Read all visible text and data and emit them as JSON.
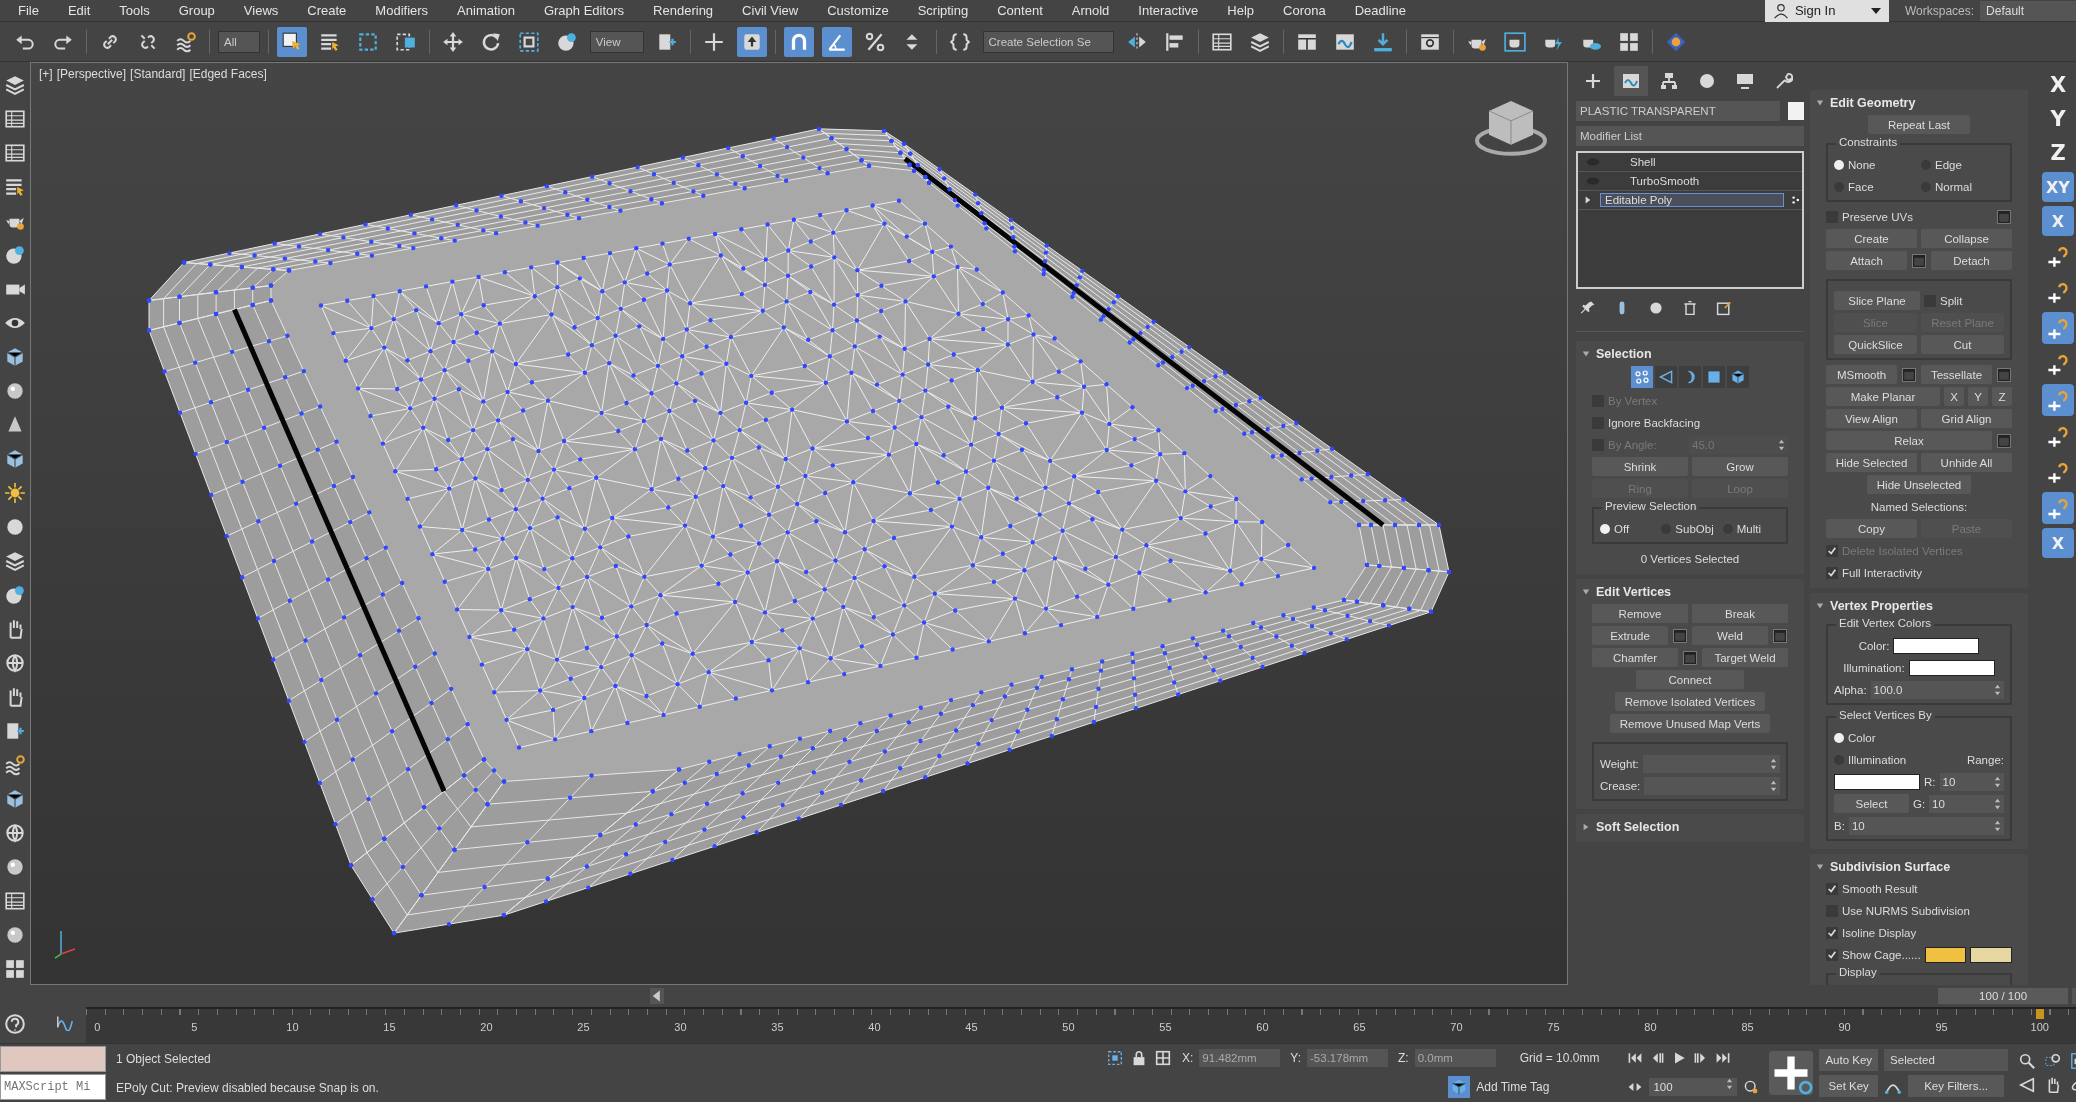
{
  "menu": [
    "File",
    "Edit",
    "Tools",
    "Group",
    "Views",
    "Create",
    "Modifiers",
    "Animation",
    "Graph Editors",
    "Rendering",
    "Civil View",
    "Customize",
    "Scripting",
    "Content",
    "Arnold",
    "Interactive",
    "Help",
    "Corona",
    "Deadline"
  ],
  "sign_in": "Sign In",
  "workspaces": {
    "label": "Workspaces:",
    "value": "Default"
  },
  "toolbar": [
    {
      "kind": "icon",
      "selected": false
    },
    {
      "kind": "icon",
      "selected": false
    },
    {
      "kind": "separator"
    },
    {
      "kind": "icon",
      "selected": false
    },
    {
      "kind": "icon",
      "selected": false
    },
    {
      "kind": "icon",
      "selected": false
    },
    {
      "kind": "separator"
    },
    {
      "kind": "dropdown",
      "value": "All"
    },
    {
      "kind": "separator"
    },
    {
      "kind": "icon",
      "selected": true
    },
    {
      "kind": "icon",
      "selected": false
    },
    {
      "kind": "icon",
      "selected": false
    },
    {
      "kind": "icon",
      "selected": false
    },
    {
      "kind": "separator"
    },
    {
      "kind": "icon",
      "selected": false
    },
    {
      "kind": "icon",
      "selected": false
    },
    {
      "kind": "icon",
      "selected": false
    },
    {
      "kind": "icon",
      "selected": false
    },
    {
      "kind": "dropdown",
      "value": "View"
    },
    {
      "kind": "icon",
      "selected": false
    },
    {
      "kind": "separator"
    },
    {
      "kind": "icon",
      "selected": false
    },
    {
      "kind": "icon",
      "selected": true
    },
    {
      "kind": "separator"
    },
    {
      "kind": "icon",
      "selected": true
    },
    {
      "kind": "icon",
      "selected": true
    },
    {
      "kind": "icon",
      "selected": false
    },
    {
      "kind": "icon",
      "selected": false
    },
    {
      "kind": "separator"
    },
    {
      "kind": "icon",
      "selected": false
    },
    {
      "kind": "dropdown",
      "value": "Create Selection Se"
    },
    {
      "kind": "icon",
      "selected": false
    },
    {
      "kind": "icon",
      "selected": false
    },
    {
      "kind": "separator"
    },
    {
      "kind": "icon",
      "selected": false
    },
    {
      "kind": "icon",
      "selected": false
    },
    {
      "kind": "separator"
    },
    {
      "kind": "icon",
      "selected": false
    },
    {
      "kind": "icon",
      "selected": false
    },
    {
      "kind": "icon",
      "selected": false
    },
    {
      "kind": "separator"
    },
    {
      "kind": "icon",
      "selected": false
    },
    {
      "kind": "separator"
    },
    {
      "kind": "icon",
      "selected": false
    },
    {
      "kind": "icon",
      "selected": false
    },
    {
      "kind": "icon",
      "selected": false
    },
    {
      "kind": "icon",
      "selected": false
    },
    {
      "kind": "icon",
      "selected": false
    },
    {
      "kind": "separator"
    },
    {
      "kind": "icon",
      "selected": false
    }
  ],
  "viewport": {
    "labels": [
      "[+]",
      "[Perspective]",
      "[Standard]",
      "[Edged Faces]"
    ]
  },
  "command_panel": {
    "tabs": [
      {
        "selected": false
      },
      {
        "selected": true
      },
      {
        "selected": false
      },
      {
        "selected": false
      },
      {
        "selected": false
      },
      {
        "selected": false
      }
    ],
    "object_name": "PLASTIC TRANSPARENT",
    "modifier_list": "Modifier List",
    "stack": [
      {
        "kind": "modifier",
        "label": "Shell",
        "selected": false
      },
      {
        "kind": "modifier",
        "label": "TurboSmooth",
        "selected": false
      },
      {
        "kind": "object",
        "label": "Editable Poly",
        "selected": true
      }
    ],
    "left_rollouts": [
      {
        "title": "Selection",
        "expanded": true,
        "levels": [
          {
            "selected": true
          },
          {
            "selected": false
          },
          {
            "selected": false
          },
          {
            "selected": false
          },
          {
            "selected": false
          }
        ],
        "rows": [
          {
            "kind": "row",
            "controls": [
              {
                "kind": "checkbox",
                "label": "By Vertex",
                "checked": false,
                "disabled": true
              }
            ]
          },
          {
            "kind": "row",
            "controls": [
              {
                "kind": "checkbox",
                "label": "Ignore Backfacing",
                "checked": false,
                "disabled": false
              }
            ]
          },
          {
            "kind": "row",
            "controls": [
              {
                "kind": "checkbox",
                "label": "By Angle:",
                "checked": false,
                "disabled": true
              },
              {
                "kind": "spinner",
                "value": "45.0",
                "disabled": true
              }
            ]
          },
          {
            "kind": "row",
            "controls": [
              {
                "kind": "button",
                "label": "Shrink",
                "disabled": false
              },
              {
                "kind": "button",
                "label": "Grow",
                "disabled": false
              }
            ]
          },
          {
            "kind": "row",
            "controls": [
              {
                "kind": "button",
                "label": "Ring",
                "disabled": true
              },
              {
                "kind": "button",
                "label": "Loop",
                "disabled": true
              }
            ]
          },
          {
            "kind": "group",
            "title": "Preview Selection",
            "rows": [
              {
                "kind": "row",
                "controls": [
                  {
                    "kind": "radio",
                    "label": "Off",
                    "selected": true
                  },
                  {
                    "kind": "radio",
                    "label": "SubObj",
                    "selected": false
                  },
                  {
                    "kind": "radio",
                    "label": "Multi",
                    "selected": false
                  }
                ]
              }
            ]
          },
          {
            "kind": "row",
            "controls": [
              {
                "kind": "text",
                "label": "0 Vertices Selected"
              }
            ]
          }
        ]
      },
      {
        "title": "Edit Vertices",
        "expanded": true,
        "rows": [
          {
            "kind": "row",
            "controls": [
              {
                "kind": "button",
                "label": "Remove",
                "disabled": false
              },
              {
                "kind": "button",
                "label": "Break",
                "disabled": false
              }
            ]
          },
          {
            "kind": "row",
            "controls": [
              {
                "kind": "button",
                "label": "Extrude",
                "disabled": false
              },
              {
                "kind": "settings"
              },
              {
                "kind": "button",
                "label": "Weld",
                "disabled": false
              },
              {
                "kind": "settings"
              }
            ]
          },
          {
            "kind": "row",
            "controls": [
              {
                "kind": "button",
                "label": "Chamfer",
                "disabled": false
              },
              {
                "kind": "settings"
              },
              {
                "kind": "button",
                "label": "Target Weld",
                "disabled": false
              }
            ]
          },
          {
            "kind": "row",
            "controls": [
              {
                "kind": "button",
                "label": "Connect",
                "disabled": false
              }
            ]
          },
          {
            "kind": "row",
            "controls": [
              {
                "kind": "button",
                "label": "Remove Isolated Vertices",
                "disabled": false
              }
            ]
          },
          {
            "kind": "row",
            "controls": [
              {
                "kind": "button",
                "label": "Remove Unused Map Verts",
                "disabled": false
              }
            ]
          },
          {
            "kind": "group",
            "rows": [
              {
                "kind": "row",
                "controls": [
                  {
                    "kind": "text",
                    "label": "Weight:"
                  },
                  {
                    "kind": "spinner",
                    "disabled": false
                  }
                ]
              },
              {
                "kind": "row",
                "controls": [
                  {
                    "kind": "text",
                    "label": "Crease:"
                  },
                  {
                    "kind": "spinner",
                    "disabled": false
                  }
                ]
              }
            ]
          }
        ]
      },
      {
        "title": "Soft Selection",
        "expanded": false
      }
    ],
    "right_rollouts": [
      {
        "title": "Edit Geometry",
        "expanded": true,
        "rows": [
          {
            "kind": "row",
            "controls": [
              {
                "kind": "button",
                "label": "Repeat Last",
                "disabled": false
              }
            ]
          },
          {
            "kind": "group",
            "title": "Constraints",
            "rows": [
              {
                "kind": "row",
                "controls": [
                  {
                    "kind": "radio",
                    "label": "None",
                    "selected": true
                  },
                  {
                    "kind": "radio",
                    "label": "Edge",
                    "selected": false
                  }
                ]
              },
              {
                "kind": "row",
                "controls": [
                  {
                    "kind": "radio",
                    "label": "Face",
                    "selected": false
                  },
                  {
                    "kind": "radio",
                    "label": "Normal",
                    "selected": false
                  }
                ]
              }
            ]
          },
          {
            "kind": "row",
            "controls": [
              {
                "kind": "checkbox",
                "label": "Preserve UVs",
                "checked": false,
                "disabled": false
              },
              {
                "kind": "settings"
              }
            ]
          },
          {
            "kind": "row",
            "controls": [
              {
                "kind": "button",
                "label": "Create",
                "disabled": false
              },
              {
                "kind": "button",
                "label": "Collapse",
                "disabled": false
              }
            ]
          },
          {
            "kind": "row",
            "controls": [
              {
                "kind": "button",
                "label": "Attach",
                "disabled": false
              },
              {
                "kind": "settings"
              },
              {
                "kind": "button",
                "label": "Detach",
                "disabled": false
              }
            ]
          },
          {
            "kind": "group",
            "rows": [
              {
                "kind": "row",
                "controls": [
                  {
                    "kind": "button",
                    "label": "Slice Plane",
                    "disabled": false
                  },
                  {
                    "kind": "checkbox",
                    "label": "Split",
                    "checked": false,
                    "disabled": false
                  }
                ]
              },
              {
                "kind": "row",
                "controls": [
                  {
                    "kind": "button",
                    "label": "Slice",
                    "disabled": true
                  },
                  {
                    "kind": "button",
                    "label": "Reset Plane",
                    "disabled": true
                  }
                ]
              },
              {
                "kind": "row",
                "controls": [
                  {
                    "kind": "button",
                    "label": "QuickSlice",
                    "disabled": false
                  },
                  {
                    "kind": "button",
                    "label": "Cut",
                    "disabled": false
                  }
                ]
              }
            ]
          },
          {
            "kind": "row",
            "controls": [
              {
                "kind": "button",
                "label": "MSmooth",
                "disabled": false
              },
              {
                "kind": "settings"
              },
              {
                "kind": "button",
                "label": "Tessellate",
                "disabled": false
              },
              {
                "kind": "settings"
              }
            ]
          },
          {
            "kind": "row",
            "controls": [
              {
                "kind": "button",
                "label": "Make Planar",
                "disabled": false
              },
              {
                "kind": "small",
                "label": "X"
              },
              {
                "kind": "small",
                "label": "Y"
              },
              {
                "kind": "small",
                "label": "Z"
              }
            ]
          },
          {
            "kind": "row",
            "controls": [
              {
                "kind": "button",
                "label": "View Align",
                "disabled": false
              },
              {
                "kind": "button",
                "label": "Grid Align",
                "disabled": false
              }
            ]
          },
          {
            "kind": "row",
            "controls": [
              {
                "kind": "button",
                "label": "Relax",
                "disabled": false
              },
              {
                "kind": "settings"
              }
            ]
          },
          {
            "kind": "row",
            "controls": [
              {
                "kind": "button",
                "label": "Hide Selected",
                "disabled": false
              },
              {
                "kind": "button",
                "label": "Unhide All",
                "disabled": false
              }
            ]
          },
          {
            "kind": "row",
            "controls": [
              {
                "kind": "button",
                "label": "Hide Unselected",
                "disabled": false
              }
            ]
          },
          {
            "kind": "row",
            "controls": [
              {
                "kind": "text",
                "label": "Named Selections:"
              }
            ]
          },
          {
            "kind": "row",
            "controls": [
              {
                "kind": "button",
                "label": "Copy",
                "disabled": false
              },
              {
                "kind": "button",
                "label": "Paste",
                "disabled": true
              }
            ]
          },
          {
            "kind": "row",
            "controls": [
              {
                "kind": "checkbox",
                "label": "Delete Isolated Vertices",
                "checked": true,
                "disabled": true
              }
            ]
          },
          {
            "kind": "row",
            "controls": [
              {
                "kind": "checkbox",
                "label": "Full Interactivity",
                "checked": true,
                "disabled": false
              }
            ]
          }
        ]
      },
      {
        "title": "Vertex Properties",
        "expanded": true,
        "rows": [
          {
            "kind": "group",
            "title": "Edit Vertex Colors",
            "rows": [
              {
                "kind": "row",
                "controls": [
                  {
                    "kind": "text",
                    "label": "Color:"
                  },
                  {
                    "kind": "swatch",
                    "color": "#ffffff"
                  }
                ]
              },
              {
                "kind": "row",
                "controls": [
                  {
                    "kind": "text",
                    "label": "Illumination:"
                  },
                  {
                    "kind": "swatch",
                    "color": "#ffffff"
                  }
                ]
              },
              {
                "kind": "row",
                "controls": [
                  {
                    "kind": "text",
                    "label": "Alpha:"
                  },
                  {
                    "kind": "spinner",
                    "value": "100.0",
                    "disabled": false
                  }
                ]
              }
            ]
          },
          {
            "kind": "group",
            "title": "Select Vertices By",
            "rows": [
              {
                "kind": "row",
                "controls": [
                  {
                    "kind": "radio",
                    "label": "Color",
                    "selected": true
                  }
                ]
              },
              {
                "kind": "row",
                "controls": [
                  {
                    "kind": "radio",
                    "label": "Illumination",
                    "selected": false
                  },
                  {
                    "kind": "text",
                    "label": "Range:"
                  }
                ]
              },
              {
                "kind": "row",
                "controls": [
                  {
                    "kind": "swatch",
                    "color": "#ffffff"
                  },
                  {
                    "kind": "text",
                    "label": "R:"
                  },
                  {
                    "kind": "spinner",
                    "value": "10",
                    "disabled": false
                  }
                ]
              },
              {
                "kind": "row",
                "controls": [
                  {
                    "kind": "button",
                    "label": "Select",
                    "disabled": false
                  },
                  {
                    "kind": "text",
                    "label": "G:"
                  },
                  {
                    "kind": "spinner",
                    "value": "10",
                    "disabled": false
                  }
                ]
              },
              {
                "kind": "row",
                "controls": [
                  {
                    "kind": "text",
                    "label": "B:"
                  },
                  {
                    "kind": "spinner",
                    "value": "10",
                    "disabled": false
                  }
                ]
              }
            ]
          }
        ]
      },
      {
        "title": "Subdivision Surface",
        "expanded": true,
        "rows": [
          {
            "kind": "row",
            "controls": [
              {
                "kind": "checkbox",
                "label": "Smooth Result",
                "checked": true,
                "disabled": false
              }
            ]
          },
          {
            "kind": "row",
            "controls": [
              {
                "kind": "checkbox",
                "label": "Use NURMS Subdivision",
                "checked": false,
                "disabled": false
              }
            ]
          },
          {
            "kind": "row",
            "controls": [
              {
                "kind": "checkbox",
                "label": "Isoline Display",
                "checked": true,
                "disabled": false
              }
            ]
          },
          {
            "kind": "row",
            "controls": [
              {
                "kind": "checkbox",
                "label": "Show Cage......",
                "checked": true,
                "disabled": false
              },
              {
                "kind": "swatch",
                "color": "#f0c040"
              },
              {
                "kind": "swatch",
                "color": "#e6d6a0"
              }
            ]
          },
          {
            "kind": "group",
            "title": "Display"
          }
        ]
      }
    ]
  },
  "right_toolbar": [
    {
      "kind": "axis",
      "label": "X",
      "selected": false
    },
    {
      "kind": "axis",
      "label": "Y",
      "selected": false
    },
    {
      "kind": "axis",
      "label": "Z",
      "selected": false
    },
    {
      "kind": "axis",
      "label": "XY",
      "selected": true
    },
    {
      "kind": "axis-snap",
      "label": "X",
      "selected": true
    },
    {
      "kind": "tool",
      "selected": false
    },
    {
      "kind": "tool",
      "selected": false
    },
    {
      "kind": "tool",
      "selected": true
    },
    {
      "kind": "tool",
      "selected": false
    },
    {
      "kind": "tool",
      "selected": true
    },
    {
      "kind": "tool",
      "selected": false
    },
    {
      "kind": "tool",
      "selected": false
    },
    {
      "kind": "tool",
      "selected": true
    },
    {
      "kind": "axis-snap",
      "label": "X",
      "selected": true
    }
  ],
  "time_slider": {
    "frame": "100 / 100",
    "level": 1,
    "ticks": [
      "0",
      "5",
      "10",
      "15",
      "20",
      "25",
      "30",
      "35",
      "40",
      "45",
      "50",
      "55",
      "60",
      "65",
      "70",
      "75",
      "80",
      "85",
      "90",
      "95",
      "100"
    ]
  },
  "status": {
    "listener": "MAXScript Mi",
    "selection": "1 Object Selected",
    "prompt": "EPoly Cut: Preview disabled because Snap is on.",
    "coords": [
      {
        "axis": "X:",
        "value": "91.482mm"
      },
      {
        "axis": "Y:",
        "value": "-53.178mm"
      },
      {
        "axis": "Z:",
        "value": "0.0mm"
      }
    ],
    "grid": "Grid = 10.0mm",
    "time_tag": "Add Time Tag",
    "frame": "100",
    "auto_key": "Auto Key",
    "set_key": "Set Key",
    "key_mode": "Selected",
    "key_filters": "Key Filters..."
  }
}
